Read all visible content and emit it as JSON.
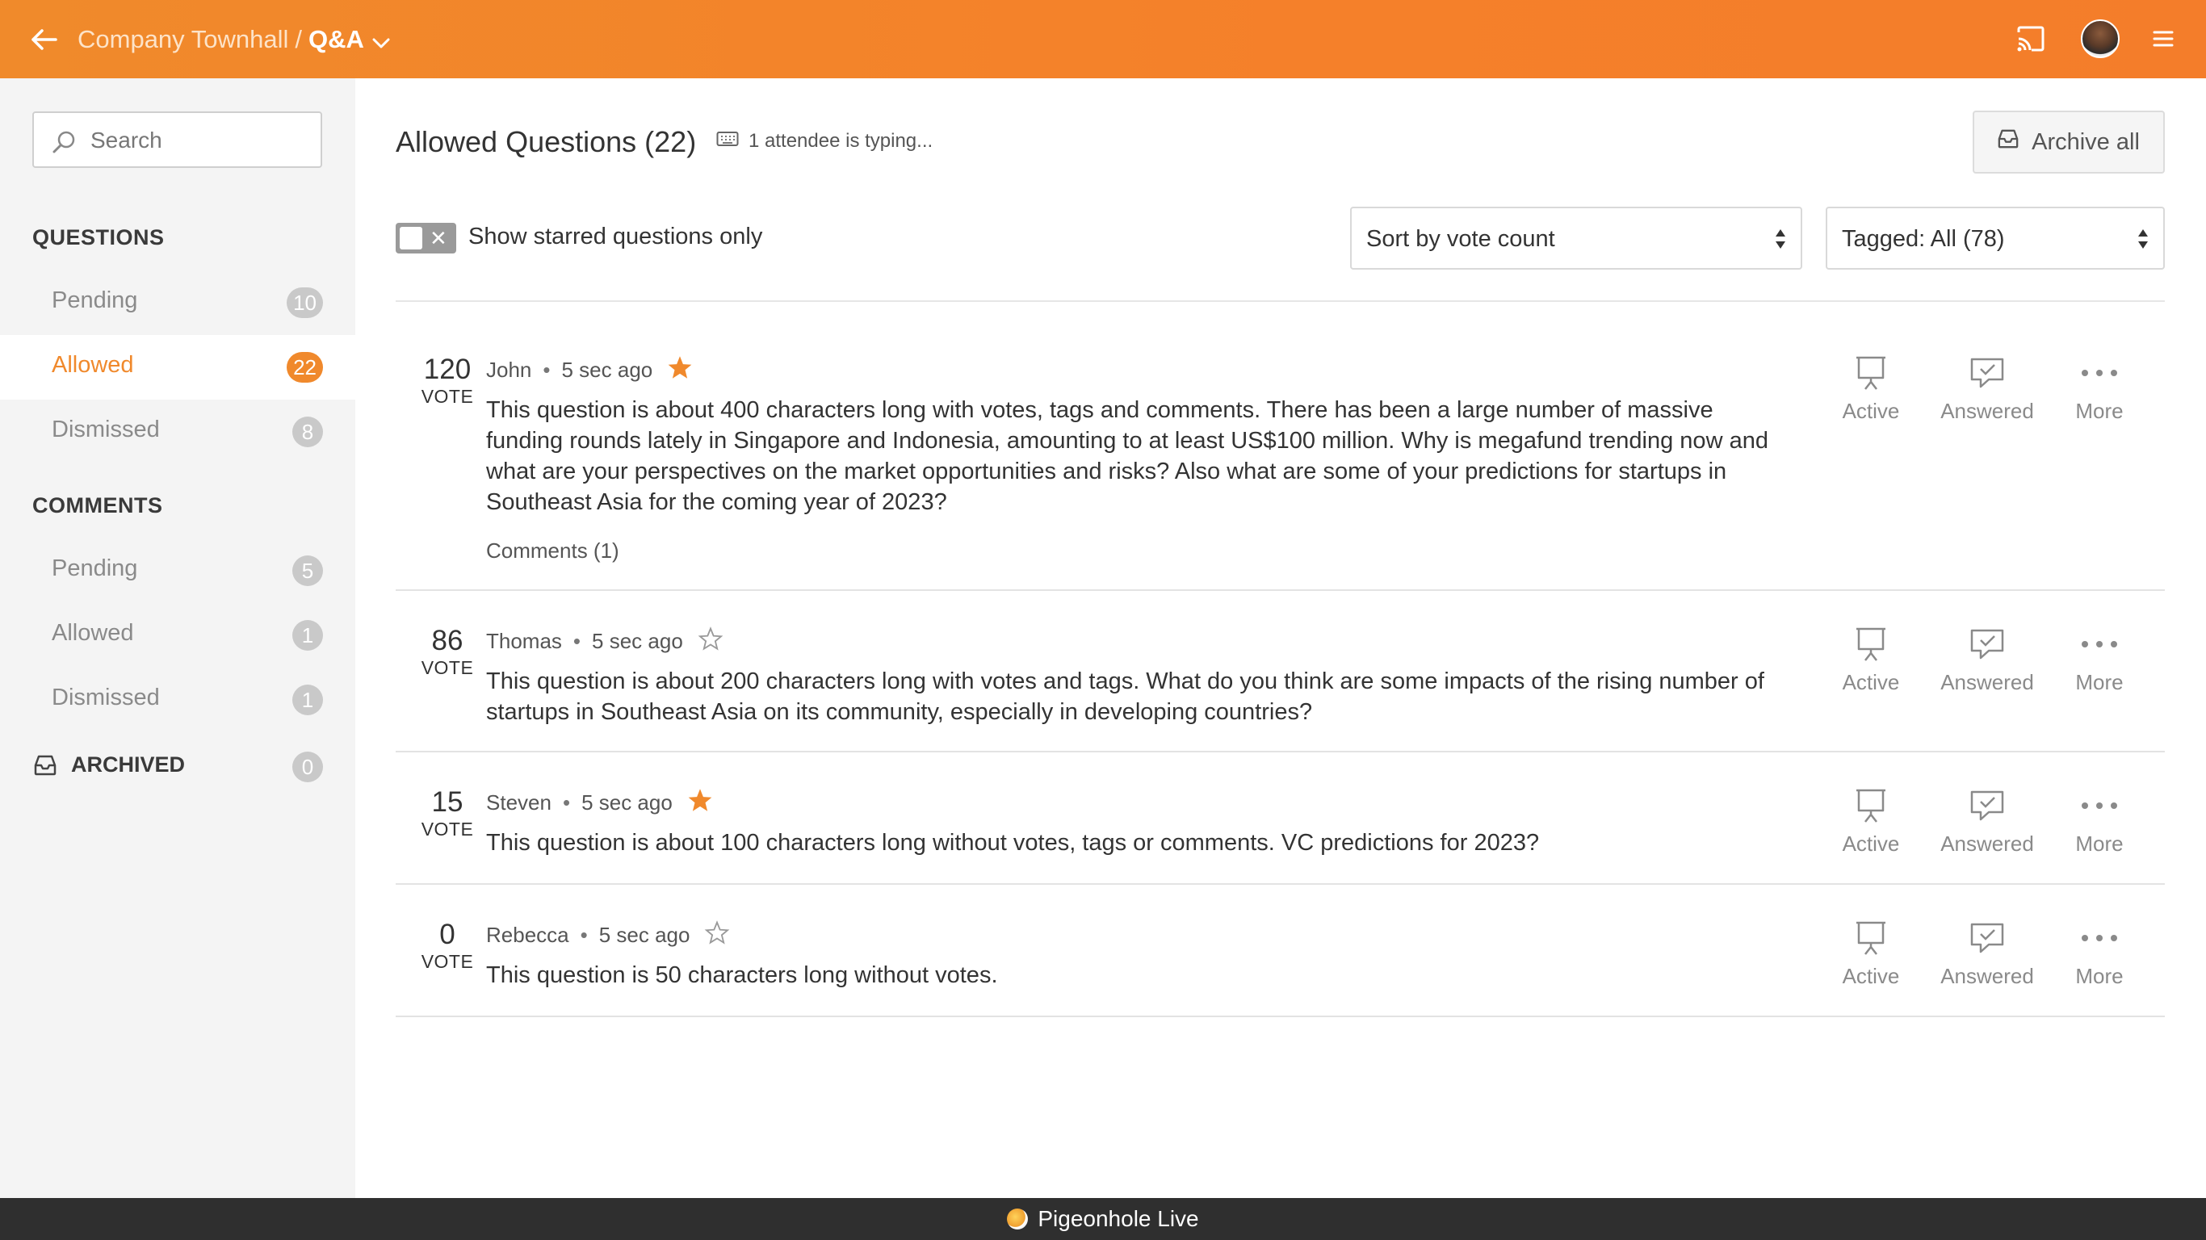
{
  "header": {
    "event_name": "Company Townhall",
    "separator": "/",
    "section": "Q&A"
  },
  "sidebar": {
    "search_placeholder": "Search",
    "questions_title": "QUESTIONS",
    "questions": [
      {
        "label": "Pending",
        "count": "10"
      },
      {
        "label": "Allowed",
        "count": "22"
      },
      {
        "label": "Dismissed",
        "count": "8"
      }
    ],
    "comments_title": "COMMENTS",
    "comments": [
      {
        "label": "Pending",
        "count": "5"
      },
      {
        "label": "Allowed",
        "count": "1"
      },
      {
        "label": "Dismissed",
        "count": "1"
      }
    ],
    "archived": {
      "label": "ARCHIVED",
      "count": "0"
    }
  },
  "main": {
    "title": "Allowed Questions (22)",
    "typing_status": "1 attendee is typing...",
    "archive_all_label": "Archive all",
    "starred_toggle_label": "Show starred questions only",
    "sort_value": "Sort by vote count",
    "tag_value": "Tagged: All (78)"
  },
  "questions": [
    {
      "votes": "120",
      "vote_label": "VOTE",
      "author": "John",
      "time": "5 sec ago",
      "starred": true,
      "text": "This question is about 400 characters long with votes, tags and comments. There has been a large number of massive funding rounds lately in Singapore and Indonesia, amounting to at least US$100 million. Why is megafund trending now and what are your perspectives on the market opportunities and risks? Also what are some of your predictions for startups in Southeast Asia for the coming year of 2023?",
      "comments": "Comments (1)"
    },
    {
      "votes": "86",
      "vote_label": "VOTE",
      "author": "Thomas",
      "time": "5 sec ago",
      "starred": false,
      "text": "This question is about 200 characters long with votes and tags. What do you think are some impacts of the rising number of startups in Southeast Asia on its community, especially in developing countries?"
    },
    {
      "votes": "15",
      "vote_label": "VOTE",
      "author": "Steven",
      "time": "5 sec ago",
      "starred": true,
      "text": "This question is about 100 characters long without votes, tags or comments. VC predictions for 2023?"
    },
    {
      "votes": "0",
      "vote_label": "VOTE",
      "author": "Rebecca",
      "time": "5 sec ago",
      "starred": false,
      "text": "This question is 50 characters long without votes."
    }
  ],
  "actions": {
    "active": "Active",
    "answered": "Answered",
    "more": "More"
  },
  "footer": {
    "brand": "Pigeonhole Live"
  },
  "colors": {
    "accent": "#f0892c",
    "header_start": "#f08a2b",
    "footer_bg": "#2f2f2f"
  }
}
